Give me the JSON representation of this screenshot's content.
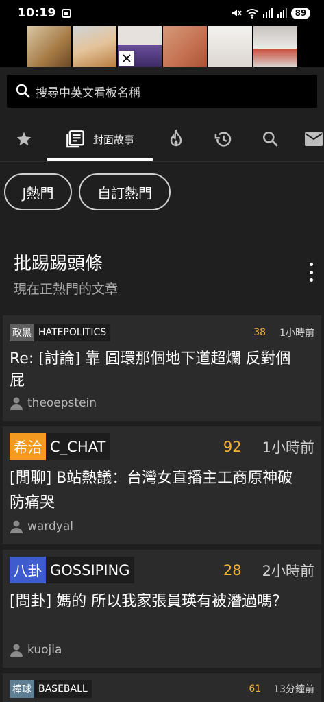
{
  "status_bar": {
    "time": "10:19",
    "battery": "89",
    "icons": [
      "notification-icon",
      "mute-icon",
      "wifi-icon",
      "signal-icon",
      "signal-icon-2",
      "battery-icon"
    ]
  },
  "ad": {
    "items": [
      "ad-thumb-1",
      "ad-thumb-2",
      "ad-thumb-3",
      "ad-thumb-4",
      "ad-thumb-5",
      "ad-thumb-6"
    ],
    "close_icon": "close-icon"
  },
  "search": {
    "placeholder": "搜尋中英文看板名稱"
  },
  "tabs": [
    {
      "icon": "star-icon",
      "label": ""
    },
    {
      "icon": "article-icon",
      "label": "封面故事"
    },
    {
      "icon": "fire-icon",
      "label": ""
    },
    {
      "icon": "history-icon",
      "label": ""
    },
    {
      "icon": "search-icon",
      "label": ""
    },
    {
      "icon": "mail-icon",
      "label": ""
    }
  ],
  "chips": [
    "J熱門",
    "自訂熱門"
  ],
  "section": {
    "title": "批踢踢頭條",
    "subtitle": "現在正熱門的文章"
  },
  "posts": [
    {
      "badge": "政黑",
      "badge_color": "#5f5f5f",
      "board": "HATEPOLITICS",
      "pushes": "38",
      "time": "1小時前",
      "title": "Re: [討論] 靠 圓環那個地下道超爛 反對個屁",
      "author": "theoepstein"
    },
    {
      "badge": "希洽",
      "badge_color": "#f39a1f",
      "board": "C_CHAT",
      "pushes": "92",
      "time": "1小時前",
      "title": "[閒聊] B站熱議：台灣女直播主工商原神破防痛哭",
      "author": "wardyal"
    },
    {
      "badge": "八卦",
      "badge_color": "#3f5ccf",
      "board": "GOSSIPING",
      "pushes": "28",
      "time": "2小時前",
      "title": "[問卦] 媽的 所以我家張員瑛有被潛過嗎？",
      "author": "kuojia"
    },
    {
      "badge": "棒球",
      "badge_color": "#5d7e93",
      "board": "BASEBALL",
      "pushes": "61",
      "time": "13分鐘前",
      "title": "",
      "author": ""
    }
  ]
}
